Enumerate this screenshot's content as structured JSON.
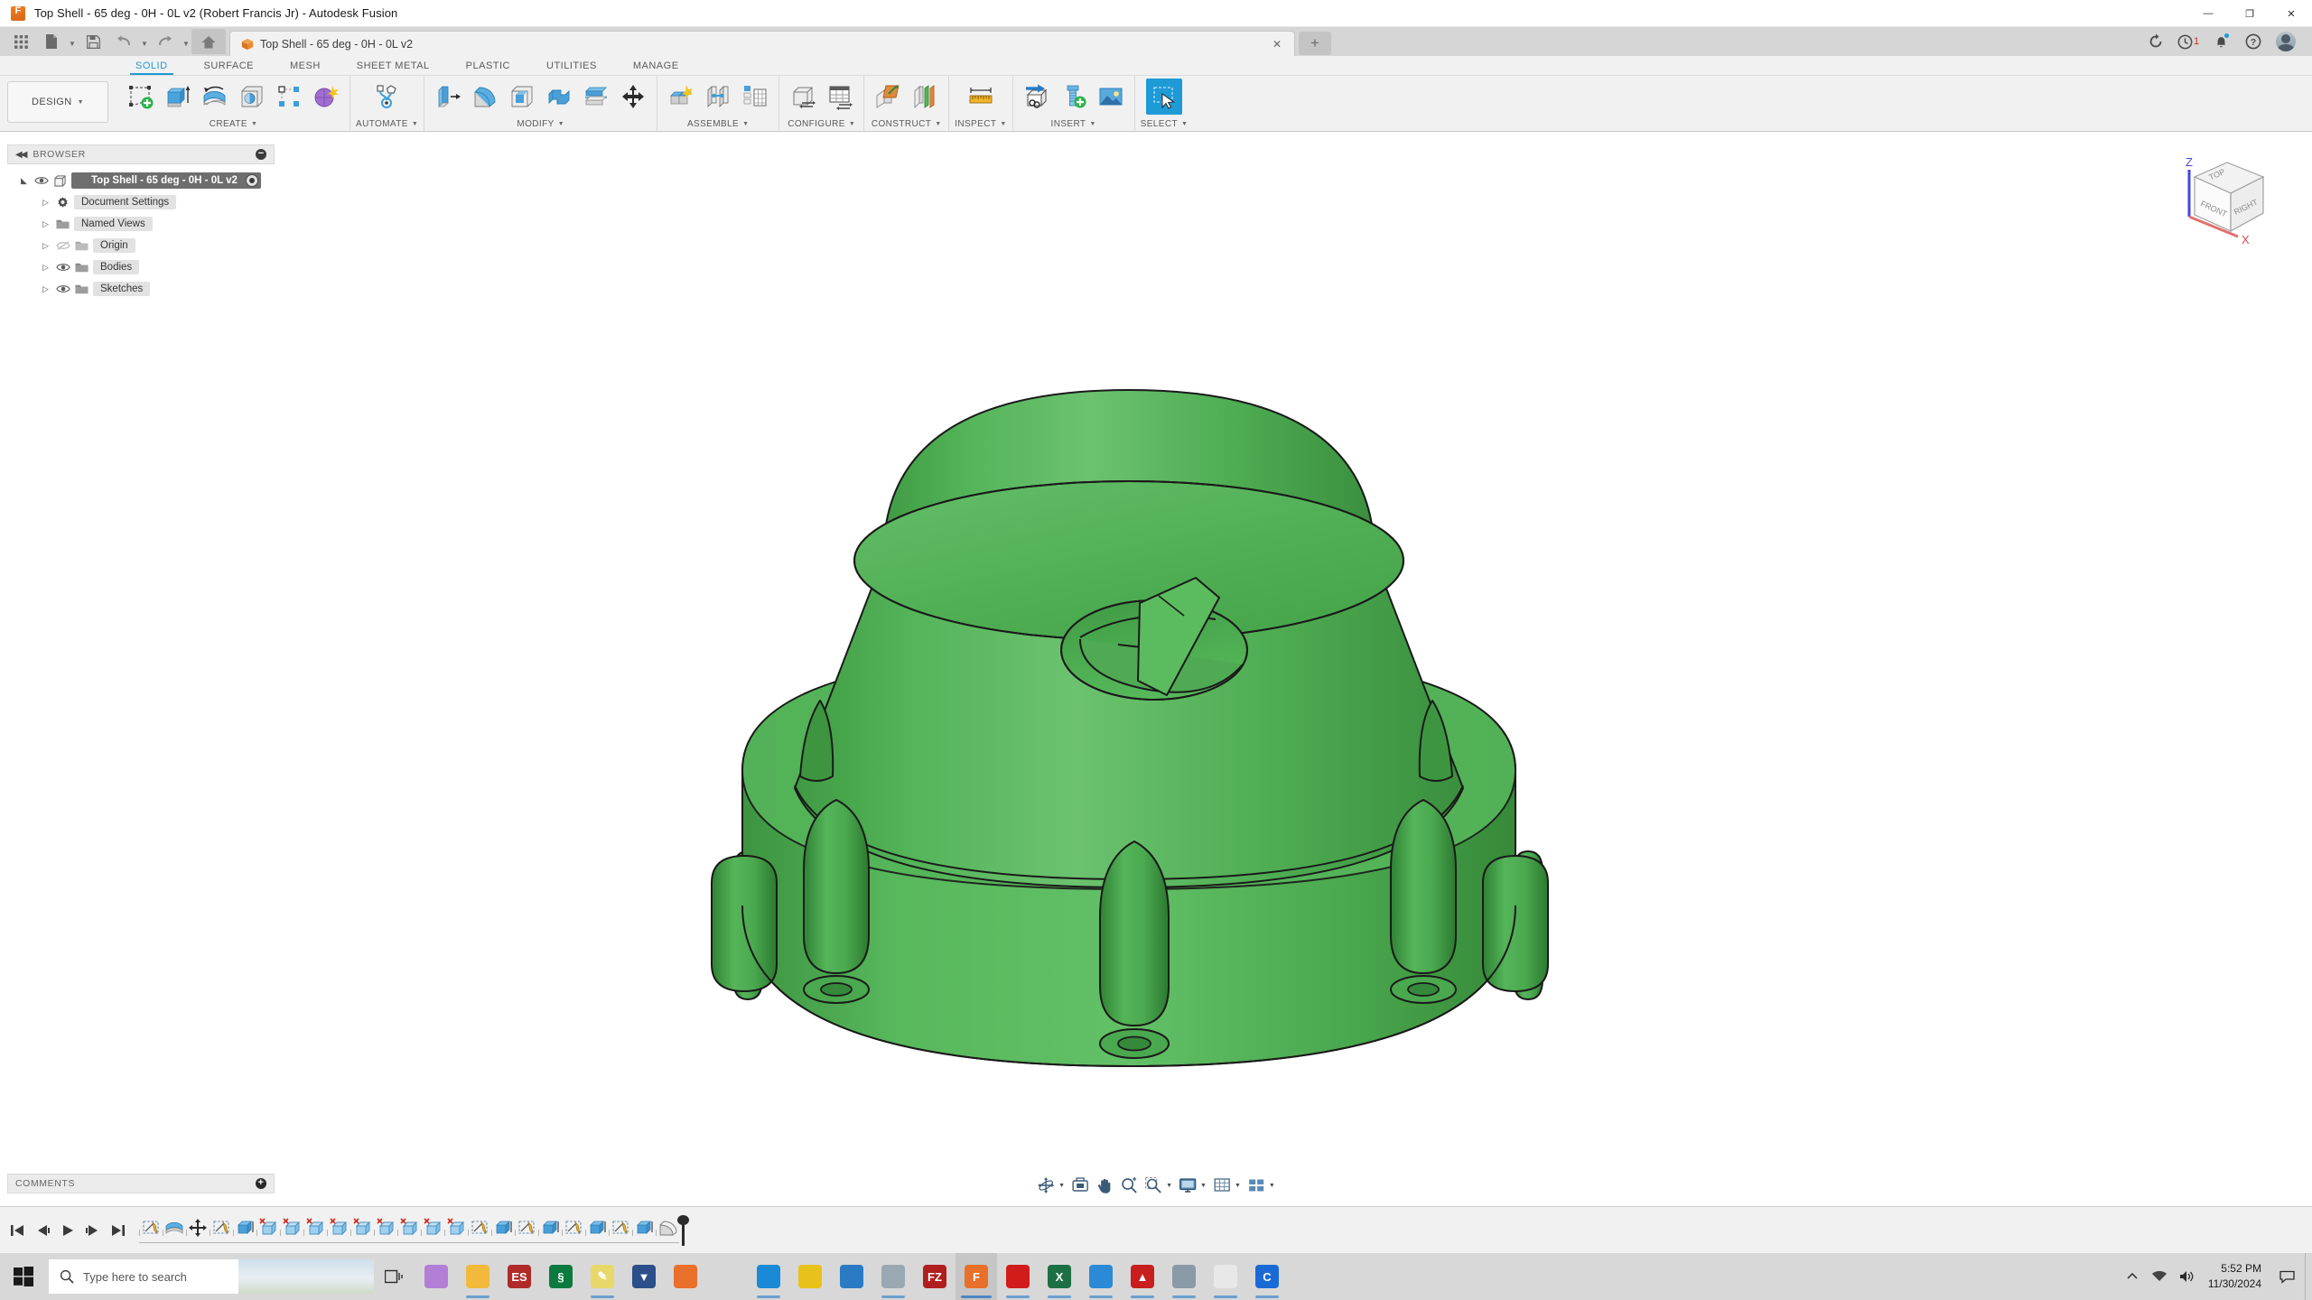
{
  "window": {
    "title": "Top Shell - 65 deg - 0H - 0L v2 (Robert Francis Jr) - Autodesk Fusion",
    "app_icon": "fusion-logo-icon",
    "minimize": "—",
    "maximize": "❐",
    "close": "✕"
  },
  "quick_access": {
    "items": [
      {
        "name": "app-grid-button",
        "icon": "grid-icon"
      },
      {
        "name": "new-file-button",
        "icon": "file-icon",
        "caret": true
      },
      {
        "name": "save-button",
        "icon": "save-icon"
      },
      {
        "name": "undo-button",
        "icon": "undo-arrow-icon",
        "caret": true
      },
      {
        "name": "redo-button",
        "icon": "redo-arrow-icon",
        "caret": true
      },
      {
        "name": "home-button",
        "icon": "home-icon"
      }
    ]
  },
  "document_tab": {
    "label": "Top Shell - 65 deg - 0H - 0L v2",
    "icon": "orange-cube-icon",
    "close": "✕",
    "new_tab": "+"
  },
  "account_bar": {
    "refresh": "refresh-icon",
    "job_status_icon": "clock-icon",
    "job_count": "1",
    "notifications": "bell-icon",
    "help": "question-mark-icon",
    "avatar": "user-avatar-icon"
  },
  "ribbon_tabs": [
    {
      "label": "SOLID",
      "active": true
    },
    {
      "label": "SURFACE",
      "active": false
    },
    {
      "label": "MESH",
      "active": false
    },
    {
      "label": "SHEET METAL",
      "active": false
    },
    {
      "label": "PLASTIC",
      "active": false
    },
    {
      "label": "UTILITIES",
      "active": false
    },
    {
      "label": "MANAGE",
      "active": false
    }
  ],
  "workspace_selector": {
    "label": "DESIGN",
    "caret": "▾"
  },
  "ribbon_panels": [
    {
      "label": "CREATE",
      "has_caret": true,
      "tools": [
        {
          "name": "create-sketch-tool",
          "icon": "sketch-plus-icon"
        },
        {
          "name": "extrude-tool",
          "icon": "extrude-icon"
        },
        {
          "name": "revolve-tool",
          "icon": "revolve-icon"
        },
        {
          "name": "hole-tool",
          "icon": "hole-icon"
        },
        {
          "name": "rectangular-pattern-tool",
          "icon": "pattern-icon"
        },
        {
          "name": "create-more-tool",
          "icon": "purple-sphere-icon"
        }
      ]
    },
    {
      "label": "AUTOMATE",
      "has_caret": true,
      "tools": [
        {
          "name": "automate-tool",
          "icon": "automate-node-icon"
        }
      ]
    },
    {
      "label": "MODIFY",
      "has_caret": true,
      "tools": [
        {
          "name": "press-pull-tool",
          "icon": "press-pull-icon"
        },
        {
          "name": "fillet-tool",
          "icon": "fillet-icon"
        },
        {
          "name": "shell-tool",
          "icon": "shell-icon"
        },
        {
          "name": "combine-tool",
          "icon": "combine-icon"
        },
        {
          "name": "split-face-tool",
          "icon": "split-icon"
        },
        {
          "name": "move-copy-tool",
          "icon": "move-arrows-icon"
        }
      ]
    },
    {
      "label": "ASSEMBLE",
      "has_caret": true,
      "tools": [
        {
          "name": "new-component-tool",
          "icon": "new-component-icon"
        },
        {
          "name": "joint-tool",
          "icon": "joint-icon"
        },
        {
          "name": "pattern-component-tool",
          "icon": "component-table-icon"
        }
      ]
    },
    {
      "label": "CONFIGURE",
      "has_caret": true,
      "tools": [
        {
          "name": "create-configuration-tool",
          "icon": "config-cube-icon"
        },
        {
          "name": "configuration-table-tool",
          "icon": "config-table-icon"
        }
      ]
    },
    {
      "label": "CONSTRUCT",
      "has_caret": true,
      "tools": [
        {
          "name": "offset-plane-tool",
          "icon": "offset-plane-icon"
        },
        {
          "name": "midplane-tool",
          "icon": "midplane-icon"
        }
      ]
    },
    {
      "label": "INSPECT",
      "has_caret": true,
      "tools": [
        {
          "name": "measure-tool",
          "icon": "ruler-icon"
        }
      ]
    },
    {
      "label": "INSERT",
      "has_caret": true,
      "tools": [
        {
          "name": "insert-derive-tool",
          "icon": "insert-derive-icon"
        },
        {
          "name": "insert-mcmaster-tool",
          "icon": "bolt-plus-icon"
        },
        {
          "name": "insert-canvas-tool",
          "icon": "image-icon"
        }
      ]
    },
    {
      "label": "SELECT",
      "has_caret": true,
      "tools": [
        {
          "name": "select-tool",
          "icon": "select-cursor-icon",
          "active": true
        }
      ]
    }
  ],
  "browser": {
    "title": "BROWSER",
    "collapse_icon": "collapse-left-icon",
    "minimize_icon": "minus-circle-icon",
    "root": {
      "label": "Top Shell - 65 deg - 0H - 0L v2",
      "icon": "component-icon",
      "selected": true,
      "activate_icon": "radio-dot-icon"
    },
    "items": [
      {
        "label": "Document Settings",
        "icon": "gear-icon",
        "visible": null
      },
      {
        "label": "Named Views",
        "icon": "folder-icon",
        "visible": null
      },
      {
        "label": "Origin",
        "icon": "folder-icon",
        "visible": false
      },
      {
        "label": "Bodies",
        "icon": "folder-icon",
        "visible": true
      },
      {
        "label": "Sketches",
        "icon": "folder-icon",
        "visible": true
      }
    ]
  },
  "view_cube": {
    "faces": {
      "top": "TOP",
      "front": "FRONT",
      "right": "RIGHT"
    },
    "axes": {
      "z": "Z",
      "x": "X"
    },
    "z_color": "#3a3ad0",
    "x_color": "#d03a3a"
  },
  "model": {
    "name": "top-shell-conical-part",
    "body_color": "#4caf50",
    "body_color_light": "#6cc26f",
    "body_color_dark": "#3f9b43",
    "edge_color": "#1a1a1a",
    "background": "#ffffff"
  },
  "comments": {
    "title": "COMMENTS",
    "add_icon": "plus-circle-icon"
  },
  "nav_bar": [
    {
      "name": "orbit-button",
      "icon": "orbit-icon",
      "caret": true
    },
    {
      "name": "look-at-button",
      "icon": "look-at-icon",
      "caret": false
    },
    {
      "name": "pan-button",
      "icon": "hand-icon",
      "caret": false
    },
    {
      "name": "zoom-button",
      "icon": "zoom-icon",
      "caret": false
    },
    {
      "name": "fit-button",
      "icon": "fit-icon",
      "caret": true
    },
    {
      "name": "display-settings-button",
      "icon": "monitor-icon",
      "caret": true
    },
    {
      "name": "grid-snaps-button",
      "icon": "grid-icon",
      "caret": true
    },
    {
      "name": "viewports-button",
      "icon": "viewport-layout-icon",
      "caret": true
    }
  ],
  "timeline": {
    "playback": [
      {
        "name": "go-to-beginning-button",
        "icon": "skip-start-icon"
      },
      {
        "name": "step-back-button",
        "icon": "step-back-icon"
      },
      {
        "name": "play-button",
        "icon": "play-icon"
      },
      {
        "name": "step-forward-button",
        "icon": "step-forward-icon"
      },
      {
        "name": "go-to-end-button",
        "icon": "skip-end-icon"
      }
    ],
    "features": [
      {
        "name": "timeline-sketch-1",
        "icon": "sketch-icon"
      },
      {
        "name": "timeline-revolve-1",
        "icon": "revolve-icon"
      },
      {
        "name": "timeline-move-1",
        "icon": "move-icon"
      },
      {
        "name": "timeline-sketch-2",
        "icon": "sketch-icon"
      },
      {
        "name": "timeline-extrude-1",
        "icon": "extrude-icon"
      },
      {
        "name": "timeline-cut-1",
        "icon": "cut-extrude-icon"
      },
      {
        "name": "timeline-cut-2",
        "icon": "cut-extrude-icon"
      },
      {
        "name": "timeline-cut-3",
        "icon": "cut-extrude-icon"
      },
      {
        "name": "timeline-cut-4",
        "icon": "cut-extrude-icon"
      },
      {
        "name": "timeline-cut-5",
        "icon": "cut-extrude-icon"
      },
      {
        "name": "timeline-cut-6",
        "icon": "cut-extrude-icon"
      },
      {
        "name": "timeline-cut-7",
        "icon": "cut-extrude-icon"
      },
      {
        "name": "timeline-cut-8",
        "icon": "cut-extrude-icon"
      },
      {
        "name": "timeline-cut-9",
        "icon": "cut-extrude-icon"
      },
      {
        "name": "timeline-sketch-3",
        "icon": "sketch-icon"
      },
      {
        "name": "timeline-extrude-2",
        "icon": "extrude-icon"
      },
      {
        "name": "timeline-sketch-4",
        "icon": "sketch-icon"
      },
      {
        "name": "timeline-extrude-3",
        "icon": "extrude-icon"
      },
      {
        "name": "timeline-sketch-5",
        "icon": "sketch-icon"
      },
      {
        "name": "timeline-extrude-4",
        "icon": "extrude-icon"
      },
      {
        "name": "timeline-sketch-6",
        "icon": "sketch-icon"
      },
      {
        "name": "timeline-extrude-5",
        "icon": "extrude-icon"
      },
      {
        "name": "timeline-fillet-1",
        "icon": "fillet-icon"
      }
    ]
  },
  "taskbar": {
    "start": "windows-logo-icon",
    "search_placeholder": "Type here to search",
    "search_icon": "magnifier-icon",
    "task_view": "task-view-icon",
    "apps": [
      {
        "name": "cortana-app",
        "icon": "cortana-icon",
        "color": "#b37fd6",
        "glyph": ""
      },
      {
        "name": "file-explorer-app",
        "icon": "folder-icon",
        "color": "#f3b93c",
        "glyph": "",
        "open": true
      },
      {
        "name": "eagle-cad-app",
        "icon": "es-icon",
        "color": "#b02a2a",
        "glyph": "ES"
      },
      {
        "name": "cura-app",
        "icon": "cura-icon",
        "color": "#0c7a3e",
        "glyph": "§"
      },
      {
        "name": "notepad-app",
        "icon": "pencil-icon",
        "color": "#e8d86a",
        "glyph": "✎",
        "open": true
      },
      {
        "name": "fusion-team-app",
        "icon": "diamond-icon",
        "color": "#2b4f8a",
        "glyph": "▼"
      },
      {
        "name": "firefox-app",
        "icon": "firefox-icon",
        "color": "#e8702a",
        "glyph": ""
      },
      {
        "name": "paint-app",
        "icon": "paint-icon",
        "color": "#d8d8d8",
        "glyph": ""
      },
      {
        "name": "edge-app",
        "icon": "edge-icon",
        "color": "#1a8ad6",
        "glyph": "",
        "open": true
      },
      {
        "name": "chrome-app",
        "icon": "chrome-icon",
        "color": "#e8c21a",
        "glyph": ""
      },
      {
        "name": "vscode-app",
        "icon": "vscode-icon",
        "color": "#2b7bc4",
        "glyph": ""
      },
      {
        "name": "printer-app",
        "icon": "printer-icon",
        "color": "#9aa8b4",
        "glyph": "",
        "open": true
      },
      {
        "name": "filezilla-app",
        "icon": "filezilla-icon",
        "color": "#b01e1e",
        "glyph": "FZ"
      },
      {
        "name": "fusion-app",
        "icon": "fusion-icon",
        "color": "#e8702a",
        "glyph": "F",
        "open": true,
        "active": true
      },
      {
        "name": "acrobat-app",
        "icon": "acrobat-icon",
        "color": "#d21b1b",
        "glyph": "",
        "open": true
      },
      {
        "name": "excel-app",
        "icon": "excel-icon",
        "color": "#1d7044",
        "glyph": "X",
        "open": true
      },
      {
        "name": "onedrive-app",
        "icon": "onedrive-icon",
        "color": "#2b8ad6",
        "glyph": "",
        "open": true
      },
      {
        "name": "adobe-reader-app",
        "icon": "pdf-icon",
        "color": "#c81e1e",
        "glyph": "▲",
        "open": true
      },
      {
        "name": "calculator-app",
        "icon": "calculator-icon",
        "color": "#8a9aa8",
        "glyph": "",
        "open": true
      },
      {
        "name": "slicer-app",
        "icon": "slicer-icon",
        "color": "#e8e8e8",
        "glyph": "",
        "open": true
      },
      {
        "name": "cortana2-app",
        "icon": "blue-c-icon",
        "color": "#1a6ad6",
        "glyph": "C",
        "open": true
      }
    ],
    "tray": [
      {
        "name": "tray-chevron",
        "icon": "chevron-up-icon"
      },
      {
        "name": "tray-network",
        "icon": "network-icon"
      },
      {
        "name": "tray-volume",
        "icon": "speaker-icon"
      }
    ],
    "time": "5:52 PM",
    "date": "11/30/2024",
    "notification_center": "speech-bubble-icon"
  }
}
